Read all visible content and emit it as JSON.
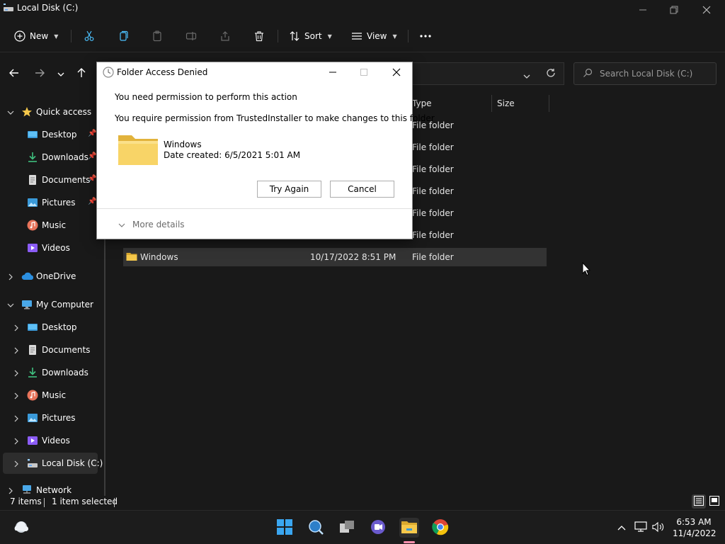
{
  "window": {
    "title": "Local Disk (C:)"
  },
  "commandbar": {
    "new_label": "New",
    "sort_label": "Sort",
    "view_label": "View"
  },
  "search": {
    "placeholder": "Search Local Disk (C:)"
  },
  "sidebar": {
    "quick_access": "Quick access",
    "quick_items": [
      "Desktop",
      "Downloads",
      "Documents",
      "Pictures",
      "Music",
      "Videos"
    ],
    "onedrive": "OneDrive",
    "my_computer": "My Computer",
    "computer_items": [
      "Desktop",
      "Documents",
      "Downloads",
      "Music",
      "Pictures",
      "Videos",
      "Local Disk (C:)"
    ],
    "network": "Network"
  },
  "columns": {
    "type": "Type",
    "size": "Size"
  },
  "files": [
    {
      "name": "",
      "date": "",
      "type": "File folder"
    },
    {
      "name": "",
      "date": "",
      "type": "File folder"
    },
    {
      "name": "",
      "date": "",
      "type": "File folder"
    },
    {
      "name": "",
      "date": "",
      "type": "File folder"
    },
    {
      "name": "",
      "date": "",
      "type": "File folder"
    },
    {
      "name": "",
      "date": "",
      "type": "File folder"
    },
    {
      "name": "Windows",
      "date": "10/17/2022 8:51 PM",
      "type": "File folder"
    }
  ],
  "status": {
    "items": "7 items",
    "selected": "1 item selected"
  },
  "dialog": {
    "title": "Folder Access Denied",
    "message": "You need permission to perform this action",
    "detail": "You require permission from TrustedInstaller to make changes to this folder",
    "folder_name": "Windows",
    "folder_date": "Date created: 6/5/2021 5:01 AM",
    "try_again": "Try Again",
    "cancel": "Cancel",
    "more_details": "More details"
  },
  "clock": {
    "time": "6:53 AM",
    "date": "11/4/2022"
  },
  "colors": {
    "folder": "#F5C84B",
    "accent": "#4CC2FF",
    "active_indicator": "#FF8FAE"
  }
}
